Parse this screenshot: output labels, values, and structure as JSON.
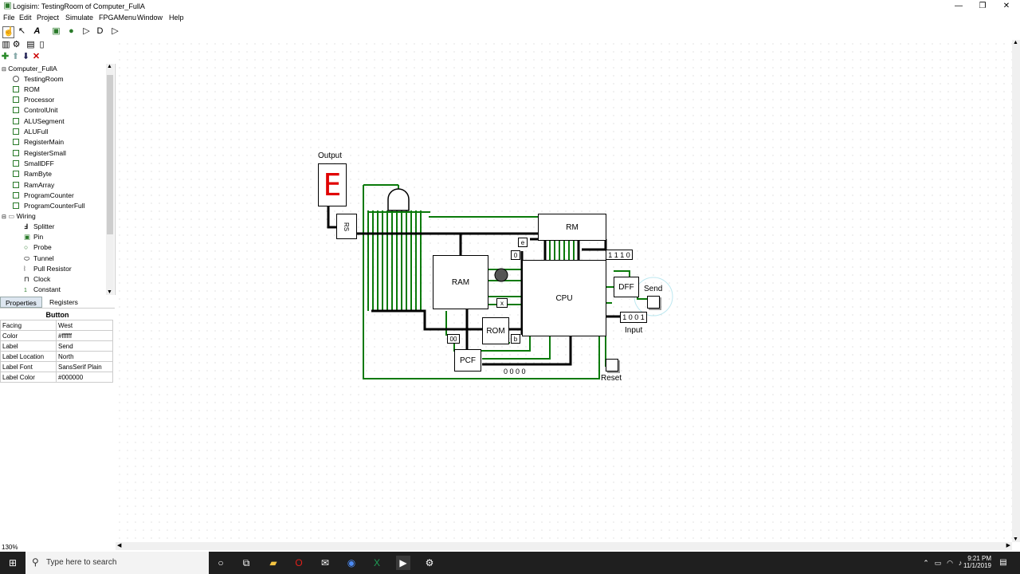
{
  "window": {
    "title": "Logisim: TestingRoom of Computer_FullA"
  },
  "menu": [
    "File",
    "Edit",
    "Project",
    "Simulate",
    "FPGAMenu",
    "Window",
    "Help"
  ],
  "tree": {
    "root": "Computer_FullA",
    "items": [
      "TestingRoom",
      "ROM",
      "Processor",
      "ControlUnit",
      "ALUSegment",
      "ALUFull",
      "RegisterMain",
      "RegisterSmall",
      "SmallDFF",
      "RamByte",
      "RamArray",
      "ProgramCounter",
      "ProgramCounterFull"
    ],
    "folder": "Wiring",
    "wiring": [
      "Splitter",
      "Pin",
      "Probe",
      "Tunnel",
      "Pull Resistor",
      "Clock",
      "Constant"
    ]
  },
  "tabs": {
    "properties": "Properties",
    "registers": "Registers"
  },
  "properties": {
    "title": "Button",
    "rows": [
      {
        "key": "Facing",
        "value": "West"
      },
      {
        "key": "Color",
        "value": "#ffffff"
      },
      {
        "key": "Label",
        "value": "Send"
      },
      {
        "key": "Label Location",
        "value": "North"
      },
      {
        "key": "Label Font",
        "value": "SansSerif Plain"
      },
      {
        "key": "Label Color",
        "value": "#000000"
      }
    ]
  },
  "zoom": "130%",
  "circuit": {
    "output_label": "Output",
    "display_digit": "E",
    "rs_label": "RS",
    "rm_label": "RM",
    "ram_label": "RAM",
    "cpu_label": "CPU",
    "rom_label": "ROM",
    "pcf_label": "PCF",
    "dff_label": "DFF",
    "send_label": "Send",
    "input_label": "Input",
    "reset_label": "Reset",
    "value_1110": "1 1 1 0",
    "value_1001": "1 0 0 1",
    "value_0000": "0 0 0 0",
    "const_e": "e",
    "const_0": "0",
    "const_00": "00",
    "const_b": "b",
    "const_x": "x"
  },
  "taskbar": {
    "search_placeholder": "Type here to search",
    "time": "9:21 PM",
    "date": "11/1/2019"
  }
}
